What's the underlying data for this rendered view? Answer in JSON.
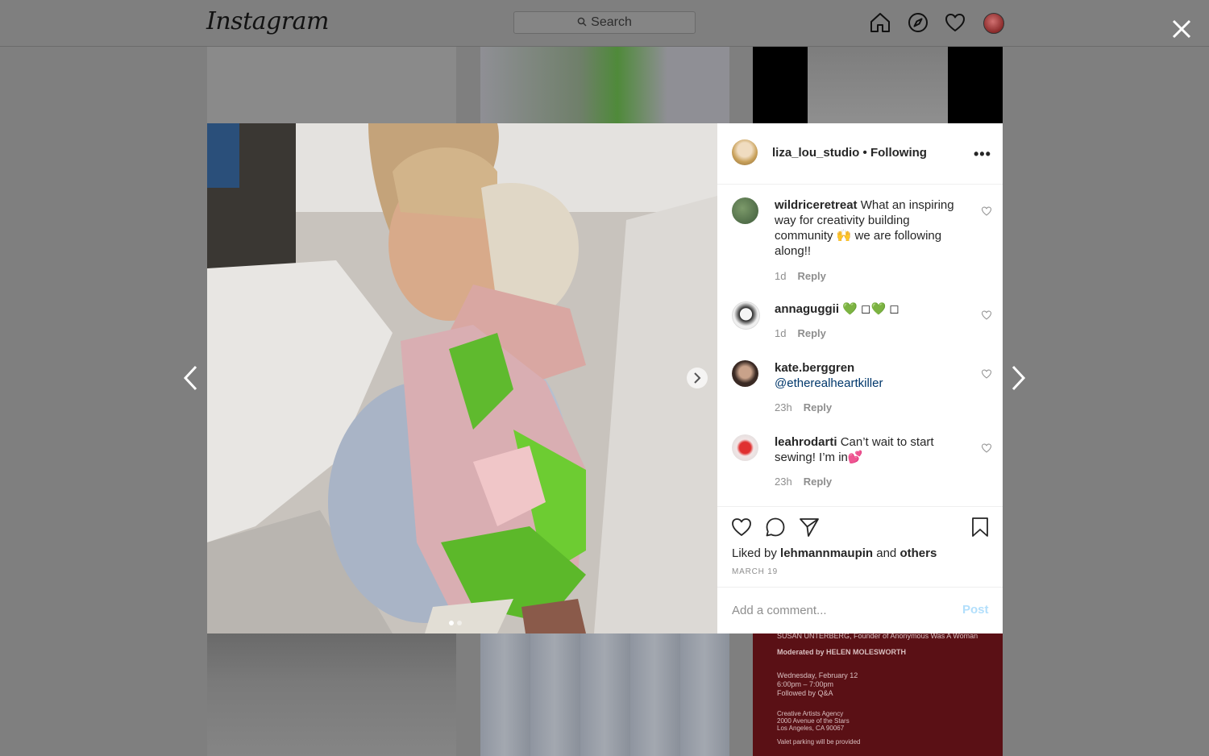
{
  "app": {
    "logo_text": "Instagram"
  },
  "search": {
    "placeholder": "Search"
  },
  "nav": {
    "icons": [
      "home-icon",
      "explore-icon",
      "activity-heart-icon",
      "profile-avatar"
    ]
  },
  "post": {
    "owner": "liza_lou_studio",
    "follow_status": "• Following",
    "comments": [
      {
        "user": "wildriceretreat",
        "text": "What an inspiring way for creativity building community 🙌  we are following along!!",
        "mention": "",
        "time": "1d",
        "reply": "Reply"
      },
      {
        "user": "annaguggii",
        "text": "💚 ◻💚 ◻",
        "mention": "",
        "time": "1d",
        "reply": "Reply"
      },
      {
        "user": "kate.berggren",
        "text": "",
        "mention": "@etherealheartkiller",
        "time": "23h",
        "reply": "Reply"
      },
      {
        "user": "leahrodarti",
        "text": "Can’t wait to start sewing! I’m in💕",
        "mention": "",
        "time": "23h",
        "reply": "Reply"
      }
    ],
    "liked_prefix": "Liked by",
    "liked_user": "lehmannmaupin",
    "liked_and": "and",
    "liked_others": "others",
    "date": "MARCH 19",
    "add_comment_placeholder": "Add a comment...",
    "post_button": "Post"
  },
  "background_poster": {
    "line1": "SUSAN UNTERBERG, Founder of Anonymous Was A Woman",
    "line2": "Moderated by HELEN MOLESWORTH",
    "line3": "Wednesday, February 12",
    "line4": "6:00pm – 7:00pm",
    "line5": "Followed by Q&A",
    "line6": "Creative Artists Agency",
    "line7": "2000 Avenue of the Stars",
    "line8": "Los Angeles, CA 90067",
    "line9": "Valet parking will be provided"
  },
  "colors": {
    "overlay": "#7f7f7f",
    "link": "#00376b",
    "post_disabled": "#b2dffc",
    "meta": "#8e8e8e"
  }
}
